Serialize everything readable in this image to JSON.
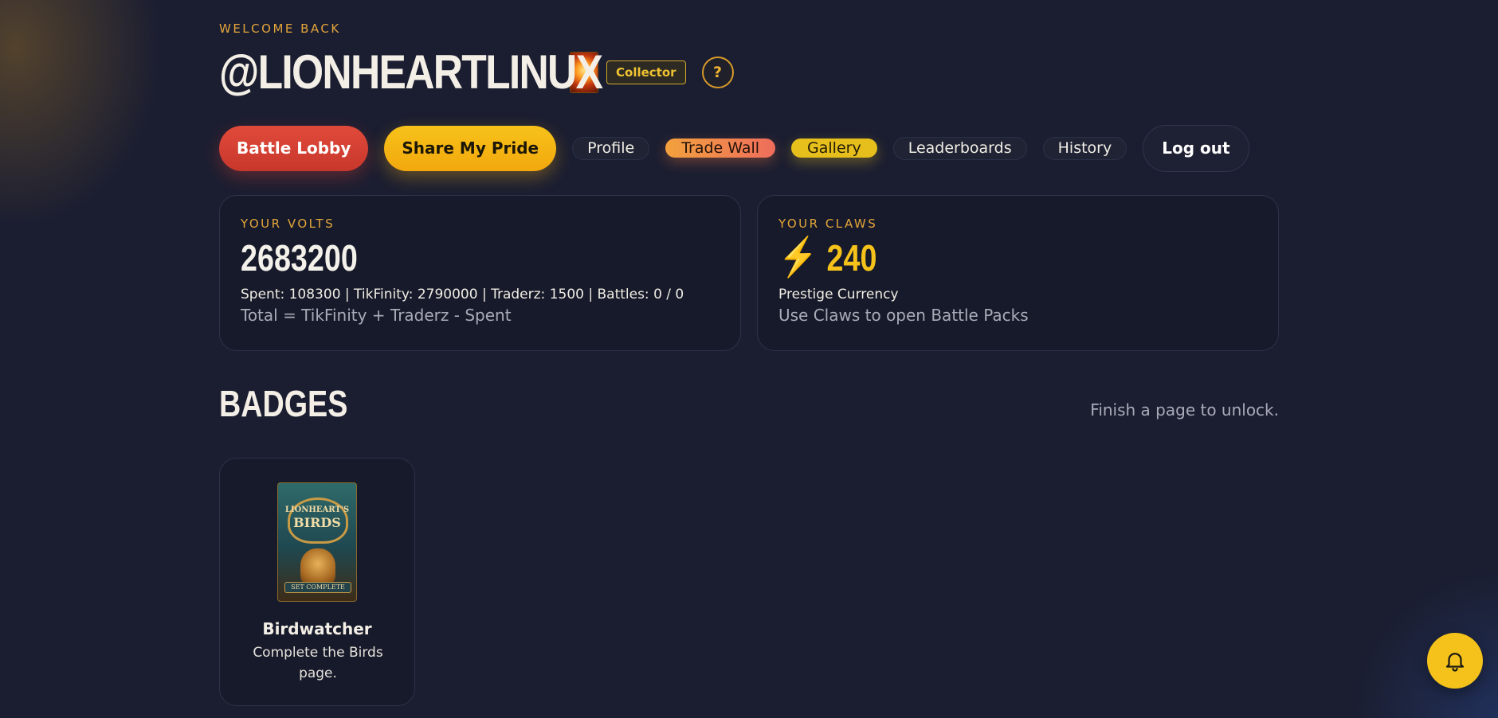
{
  "header": {
    "welcome_label": "WELCOME BACK",
    "username": "@LIONHEARTLINUX",
    "role_badge": "Collector",
    "help_label": "?"
  },
  "nav": {
    "battle_lobby": "Battle Lobby",
    "share_my_pride": "Share My Pride",
    "profile": "Profile",
    "trade_wall": "Trade Wall",
    "gallery": "Gallery",
    "leaderboards": "Leaderboards",
    "history": "History",
    "log_out": "Log out"
  },
  "volts": {
    "label": "YOUR VOLTS",
    "value": "2683200",
    "breakdown": "Spent: 108300 | TikFinity: 2790000 | Traderz: 1500 | Battles: 0 / 0",
    "formula": "Total = TikFinity + Traderz - Spent"
  },
  "claws": {
    "label": "YOUR CLAWS",
    "icon_glyph": "⚡",
    "value": "240",
    "subtitle": "Prestige Currency",
    "hint": "Use Claws to open Battle Packs"
  },
  "badges": {
    "title": "BADGES",
    "hint": "Finish a page to unlock.",
    "items": [
      {
        "art_line1": "LIONHEART'S",
        "art_line2": "BIRDS",
        "art_ribbon": "SET COMPLETE",
        "name": "Birdwatcher",
        "description": "Complete the Birds page."
      }
    ]
  },
  "colors": {
    "background": "#1b1e31",
    "accent_gold": "#f4c21a",
    "accent_orange": "#e3a53a",
    "battle_red": "#e04a3a"
  },
  "icons": {
    "help": "question-icon",
    "claws": "lightning-icon",
    "notifications": "bell-icon"
  }
}
